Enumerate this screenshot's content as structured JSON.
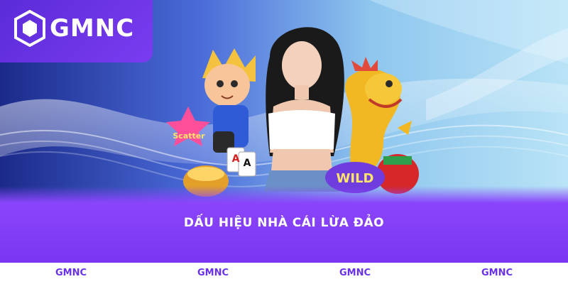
{
  "brand": {
    "logo_text": "GMNC",
    "accent": "#7a35f1"
  },
  "banner": {
    "caption": "DẤU HIỆU NHÀ CÁI LỪA ĐẢO",
    "scatter_text": "Scatter",
    "wild_text": "WILD",
    "card_letter": "A"
  },
  "footer": {
    "items": [
      "GMNC",
      "GMNC",
      "GMNC",
      "GMNC"
    ]
  }
}
